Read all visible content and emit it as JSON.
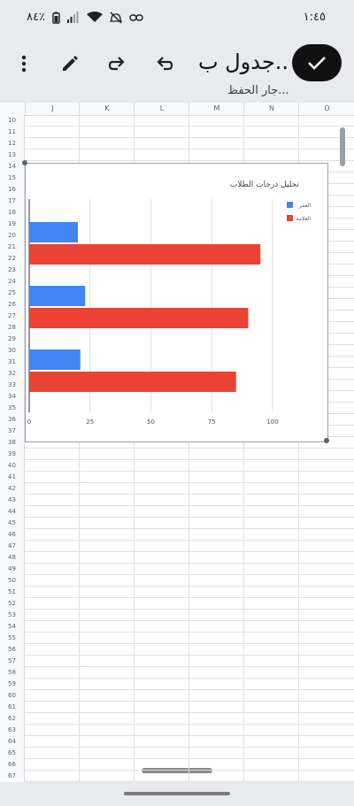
{
  "status_bar": {
    "time": "١:٤٥",
    "battery": "٨٤٪"
  },
  "toolbar": {
    "title": "جدول ب..",
    "subtitle": "جار الحفظ..."
  },
  "sheet": {
    "columns": [
      "J",
      "K",
      "L",
      "M",
      "N",
      "O"
    ],
    "rows": [
      "10",
      "11",
      "12",
      "13",
      "14",
      "15",
      "16",
      "17",
      "18",
      "19",
      "20",
      "21",
      "22",
      "23",
      "24",
      "25",
      "26",
      "27",
      "28",
      "29",
      "30",
      "31",
      "32",
      "33",
      "34",
      "35",
      "36",
      "37",
      "38",
      "39",
      "40",
      "41",
      "42",
      "43",
      "44",
      "45",
      "46",
      "47",
      "48",
      "49",
      "50",
      "51",
      "52",
      "53",
      "54",
      "55",
      "56",
      "57",
      "58",
      "59",
      "60",
      "61",
      "62",
      "63",
      "64",
      "65",
      "66",
      "67"
    ]
  },
  "chart_data": {
    "type": "bar",
    "orientation": "horizontal",
    "title": "تحليل درجات الطلاب",
    "categories": [
      "",
      "",
      ""
    ],
    "series": [
      {
        "name": "العمر",
        "color": "#4285f4",
        "values": [
          20,
          23,
          21
        ]
      },
      {
        "name": "العلامة",
        "color": "#ea4335",
        "values": [
          95,
          90,
          85
        ]
      }
    ],
    "xticks": [
      0,
      25,
      50,
      75,
      100
    ],
    "xlim": [
      0,
      100
    ],
    "grid": true,
    "legend": "top-right"
  }
}
